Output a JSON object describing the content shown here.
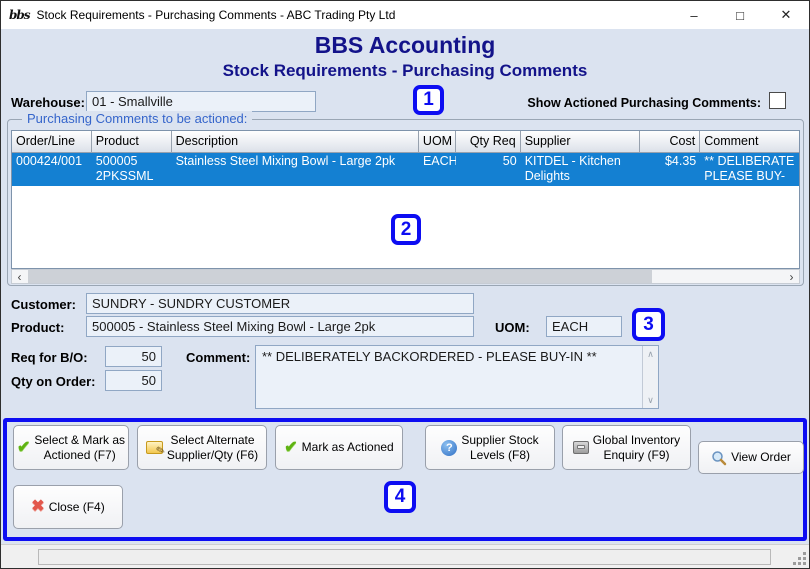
{
  "window": {
    "title": "Stock Requirements - Purchasing Comments - ABC Trading Pty Ltd",
    "logo_text": "bbs",
    "controls": {
      "minimize": "–",
      "maximize": "□",
      "close": "✕"
    }
  },
  "header": {
    "app_name": "BBS Accounting",
    "screen_title": "Stock Requirements - Purchasing Comments"
  },
  "fields": {
    "warehouse": {
      "label": "Warehouse:",
      "value": "01 - Smallville"
    },
    "show_actioned_label": "Show Actioned Purchasing Comments:",
    "customer": {
      "label": "Customer:",
      "value": "SUNDRY - SUNDRY CUSTOMER"
    },
    "product": {
      "label": "Product:",
      "value": "500005 - Stainless Steel Mixing Bowl - Large 2pk"
    },
    "uom": {
      "label": "UOM:",
      "value": "EACH"
    },
    "req_for_bo": {
      "label": "Req for B/O:",
      "value": "50"
    },
    "qty_on_order": {
      "label": "Qty on Order:",
      "value": "50"
    },
    "comment": {
      "label": "Comment:",
      "value": "** DELIBERATELY BACKORDERED - PLEASE BUY-IN **"
    }
  },
  "group": {
    "title": "Purchasing Comments to be actioned:"
  },
  "table": {
    "columns": [
      "Order/Line",
      "Product",
      "Description",
      "UOM",
      "Qty Req",
      "Supplier",
      "Cost",
      "Comment"
    ],
    "rows": [
      {
        "order_line": "000424/001",
        "product": "500005\n2PKSSML",
        "description": "Stainless Steel Mixing Bowl - Large 2pk",
        "uom": "EACH",
        "qty_req": "50",
        "supplier": "KITDEL - Kitchen\nDelights",
        "cost": "$4.35",
        "comment": "** DELIBERATE\nPLEASE BUY-IN"
      }
    ]
  },
  "buttons": {
    "select_mark": "Select & Mark as\nActioned (F7)",
    "select_alternate": "Select Alternate\nSupplier/Qty (F6)",
    "mark_actioned": "Mark as Actioned",
    "supplier_stock": "Supplier Stock\nLevels (F8)",
    "global_inventory": "Global Inventory\nEnquiry (F9)",
    "view_order": "View Order",
    "close": "Close (F4)"
  },
  "icons": {
    "check": "✔",
    "pencil": "✎",
    "question": "?",
    "close_x": "✖",
    "scroll_left": "‹",
    "scroll_right": "›",
    "scroll_up": "∧",
    "scroll_down": "∨"
  },
  "annotations": {
    "n1": "1",
    "n2": "2",
    "n3": "3",
    "n4": "4"
  },
  "colors": {
    "accent_blue": "#0d0df2",
    "selected_row": "#1480d2",
    "title_navy": "#13138a"
  }
}
